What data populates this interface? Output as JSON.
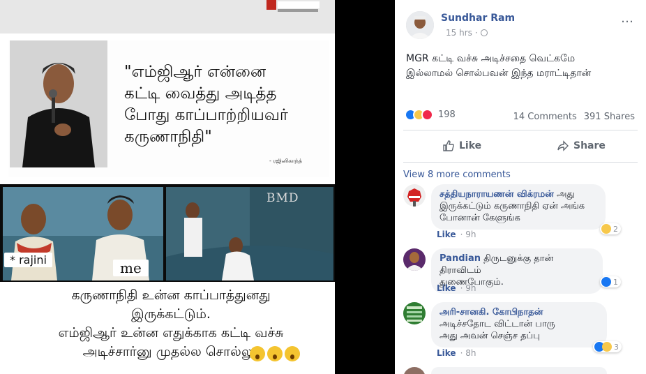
{
  "media": {
    "quote": "\"எம்ஜிஆர் என்னை\nகட்டி வைத்து அடித்த\nபோது காப்பாற்றியவர்\nகருணாநிதி\"",
    "attribution": "- ரஜினிகாந்த்",
    "tag_rajini": "* rajini",
    "tag_me": "me",
    "watermark": "BMD",
    "caption": "கருணாநிதி உன்ன காப்பாத்துனது\nஇருக்கட்டும்.\nஎம்ஜிஆர் உன்ன எதுக்காக கட்டி வச்சு\nஅடிச்சார்னு முதல்ல சொல்லு."
  },
  "post": {
    "author": "Sundhar Ram",
    "time": "15 hrs",
    "more_icon": "…",
    "text": "MGR கட்டி வச்சு அடிச்சதை வெட்கமே\nஇல்லாமல் சொல்பவன் இந்த மராட்டிதான்",
    "reaction_count": "198",
    "comments_count": "14 Comments",
    "shares_count": "391 Shares",
    "like_label": "Like",
    "share_label": "Share",
    "view_more": "View 8 more comments"
  },
  "comments": [
    {
      "name": "சத்தியநாராயணன் விக்ரமன்",
      "text_line1": "அது",
      "text_line2": "இருக்கட்டும் கருணாநிதி ஏன் அங்க",
      "text_line3": "போனான் கேளுங்க",
      "like": "Like",
      "time": "9h",
      "reactions": "2"
    },
    {
      "name": "Pandian",
      "text_line1": "திருடனுக்கு தான் திராவிடம்",
      "text_line2": "துணைபோகும்.",
      "like": "Like",
      "time": "9h",
      "reactions": "1"
    },
    {
      "name": "அரி-சானகி. கோபிநாதன்",
      "text_line1": "அடிச்சதோட விட்டான் பாரு",
      "text_line2": "அது அவன் செஞ்ச தப்பு",
      "like": "Like",
      "time": "8h",
      "reactions": "3"
    }
  ],
  "colors": {
    "link": "#385898",
    "muted": "#90949c",
    "bubble": "#f2f3f5",
    "like_blue": "#1877f2"
  }
}
